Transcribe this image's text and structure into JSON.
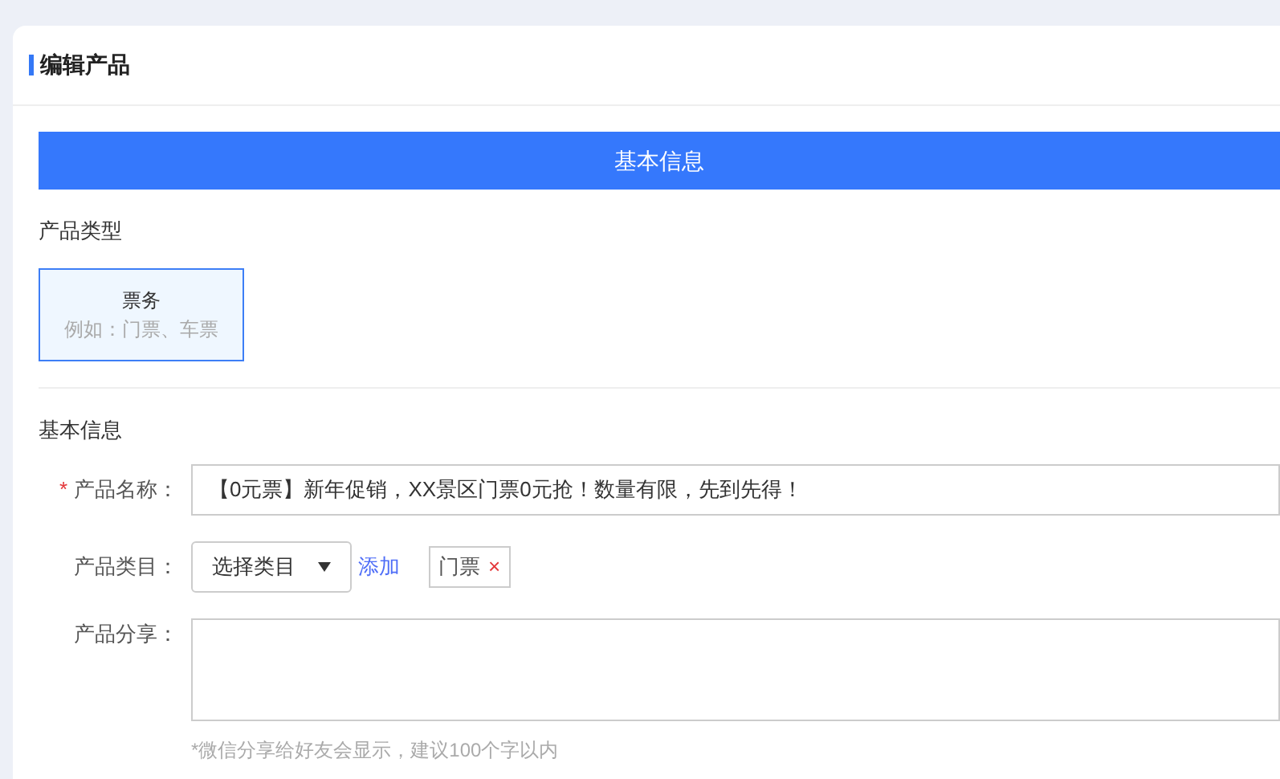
{
  "page_title": "编辑产品",
  "section_banner": "基本信息",
  "product_type": {
    "heading": "产品类型",
    "options": [
      {
        "title": "票务",
        "example": "例如：门票、车票",
        "selected": true
      }
    ]
  },
  "basic_info": {
    "heading": "基本信息",
    "fields": [
      {
        "kind": "text",
        "label": "产品名称：",
        "required_mark": "*",
        "value": "【0元票】新年促销，XX景区门票0元抢！数量有限，先到先得！"
      },
      {
        "kind": "category",
        "label": "产品类目：",
        "select": "选择类目",
        "add_link": "添加",
        "tags": [
          {
            "text": "门票",
            "remove": "×"
          }
        ]
      },
      {
        "kind": "textarea",
        "label": "产品分享：",
        "hint": "*微信分享给好友会显示，建议100个字以内"
      }
    ]
  }
}
